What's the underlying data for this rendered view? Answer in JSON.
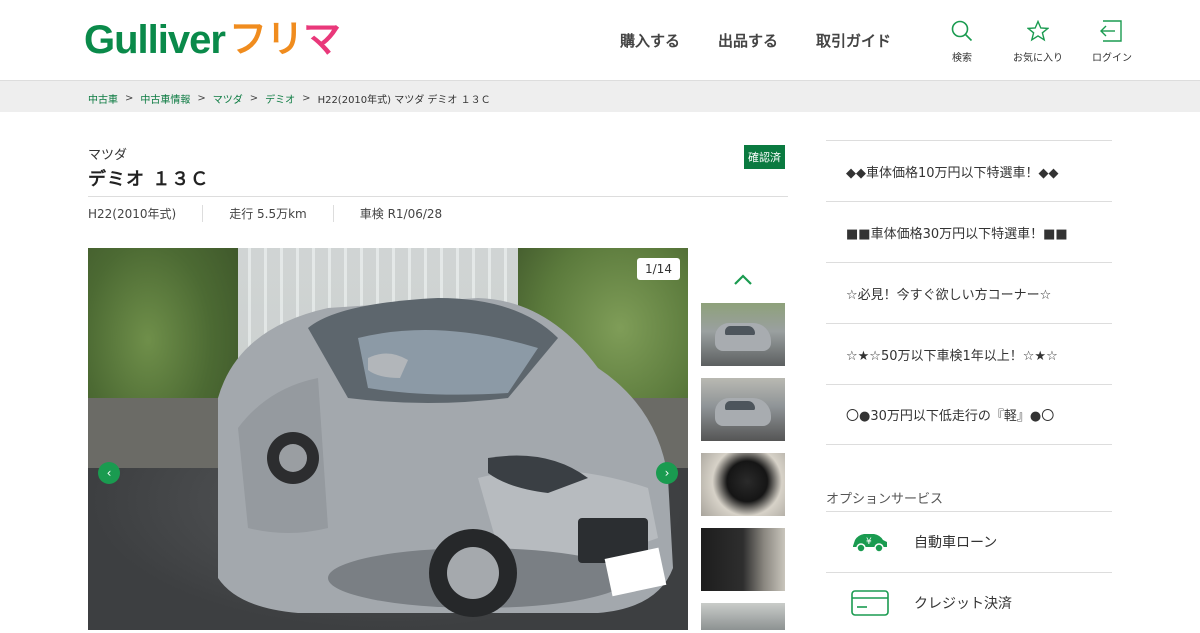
{
  "brand": {
    "logo_main": "Gulliver",
    "logo_sub_1": "フリ",
    "logo_sub_2": "マ"
  },
  "nav": [
    "購入する",
    "出品する",
    "取引ガイド"
  ],
  "header_icons": [
    {
      "label": "検索",
      "icon": "search-icon"
    },
    {
      "label": "お気に入り",
      "icon": "star-icon"
    },
    {
      "label": "ログイン",
      "icon": "login-icon"
    }
  ],
  "breadcrumb": [
    "中古車",
    "中古車情報",
    "マツダ",
    "デミオ",
    "H22(2010年式) マツダ デミオ １３Ｃ"
  ],
  "breadcrumb_sep": ">",
  "car": {
    "maker": "マツダ",
    "model": "デミオ １３Ｃ",
    "badge": "確認済",
    "year": "H22(2010年式)",
    "mileage": "走行 5.5万km",
    "inspection": "車検 R1/06/28"
  },
  "gallery": {
    "counter": "1/14",
    "prev": "‹",
    "next": "›"
  },
  "sidebar_links": [
    "◆◆車体価格10万円以下特選車！◆◆",
    "■■車体価格30万円以下特選車！■■",
    "☆必見！今すぐ欲しい方コーナー☆",
    "☆★☆50万以下車検1年以上！☆★☆",
    "〇●30万円以下低走行の『軽』●〇"
  ],
  "options": {
    "title": "オプションサービス",
    "items": [
      {
        "label": "自動車ローン",
        "icon": "car-loan-icon"
      },
      {
        "label": "クレジット決済",
        "icon": "credit-card-icon"
      }
    ]
  },
  "colors": {
    "brand_green": "#0a8a4a",
    "accent_orange": "#f08c1e",
    "accent_pink": "#e9387a",
    "link_green": "#0a7a40"
  }
}
